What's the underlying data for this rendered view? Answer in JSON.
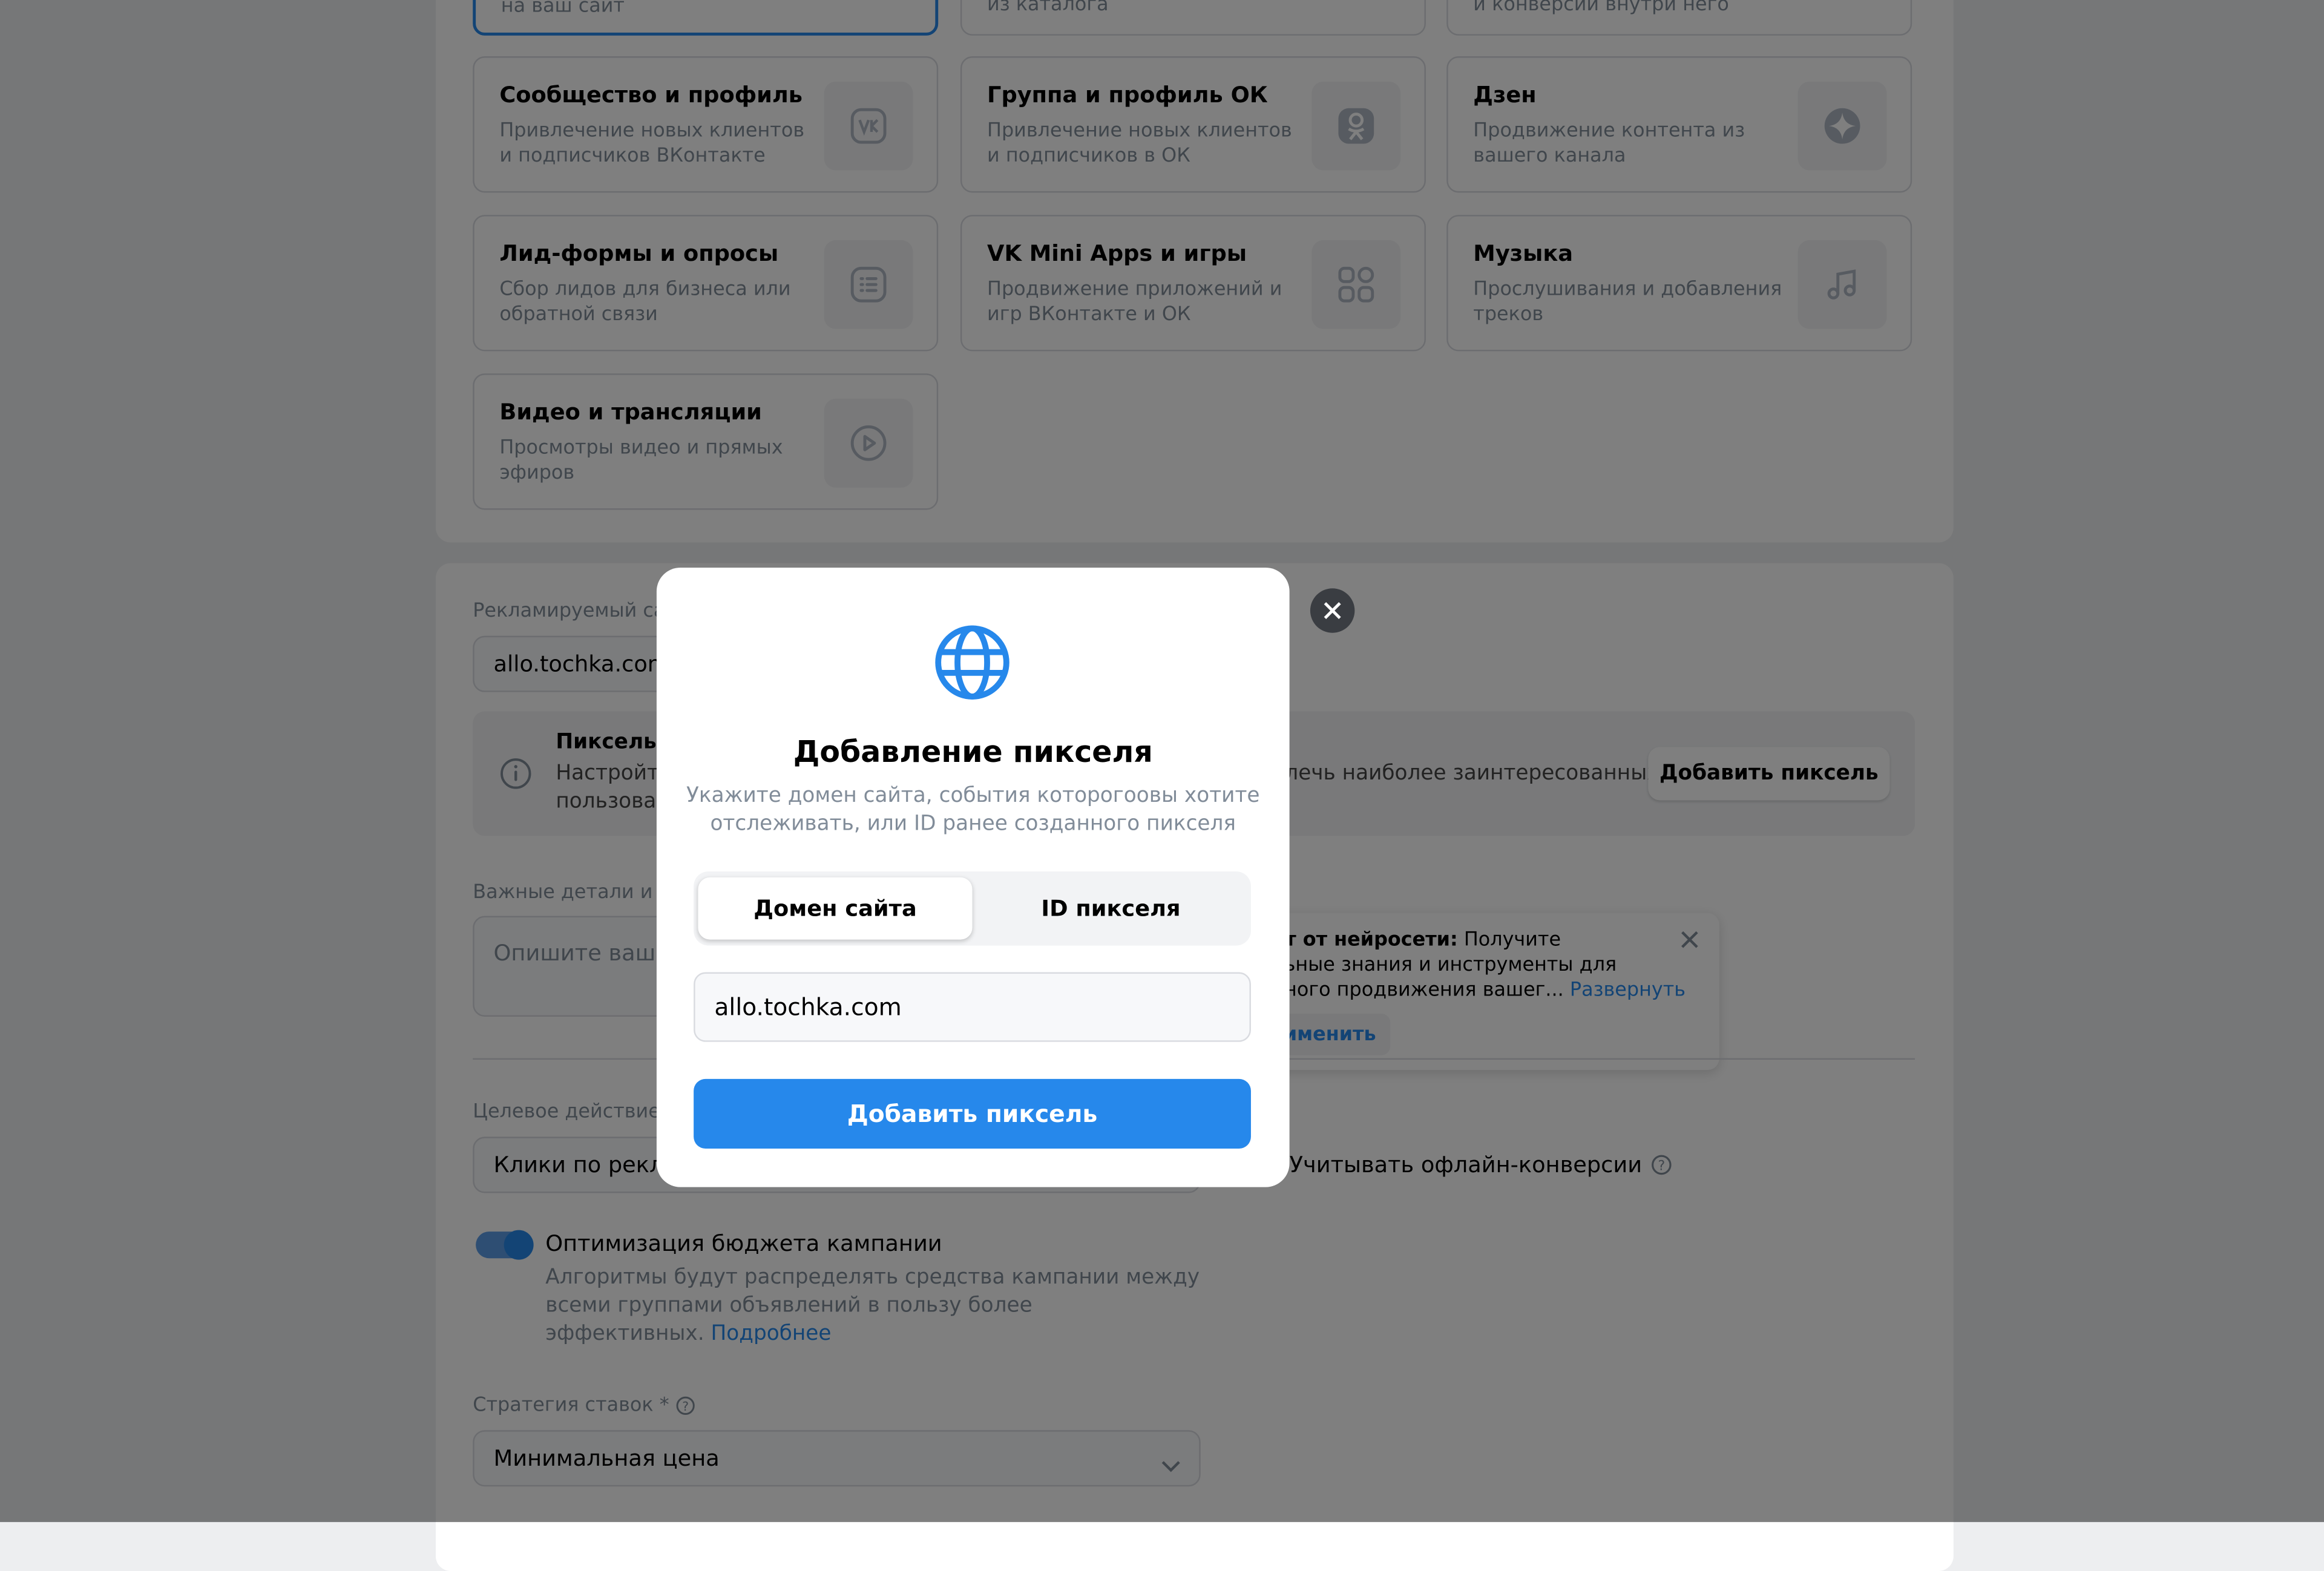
{
  "cards": [
    {
      "title": "Сообщество и профиль",
      "desc": "Привлечение новых клиентов и подписчиков ВКонтакте",
      "icon": "vk-icon"
    },
    {
      "title": "Группа и профиль ОК",
      "desc": "Привлечение новых клиентов и подписчиков в ОК",
      "icon": "ok-icon"
    },
    {
      "title": "Дзен",
      "desc": "Продвижение контента из вашего канала",
      "icon": "dzen-icon"
    },
    {
      "title": "Лид-формы и опросы",
      "desc": "Сбор лидов для бизнеса или обратной связи",
      "icon": "list-icon"
    },
    {
      "title": "VK Mini Apps и игры",
      "desc": "Продвижение приложений и игр ВКонтакте и ОК",
      "icon": "apps-icon"
    },
    {
      "title": "Музыка",
      "desc": "Прослушивания и добавления треков",
      "icon": "music-note-icon"
    },
    {
      "title": "Видео и трансляции",
      "desc": "Просмотры видео и прямых эфиров",
      "icon": "play-icon"
    }
  ],
  "top_cards": {
    "left": "на ваш сайт",
    "middle": "из каталога",
    "right": "и конверсии внутри него"
  },
  "site": {
    "label": "Рекламируемый сай",
    "value": "allo.tochka.com"
  },
  "pixel_notice": {
    "title": "Пиксель н",
    "line1": "Настройте",
    "line1_right": "лечь наиболее заинтересованных",
    "line2": "пользоват",
    "button": "Добавить пиксель"
  },
  "details": {
    "label": "Важные детали и от",
    "placeholder": "Опишите ваше"
  },
  "ai_tip": {
    "bold": "нт от нейросети:",
    "text1": " Получите",
    "text2": "льные знания и инструменты для",
    "text3": "нного продвижения вашег...",
    "expand": "Развернуть",
    "apply": "именить"
  },
  "target": {
    "label": "Целевое действие *",
    "value": "Клики по рекла",
    "offline": "Учитывать офлайн-конверсии"
  },
  "budget": {
    "title": "Оптимизация бюджета кампании",
    "desc1": "Алгоритмы будут распределять средства кампании между",
    "desc2": "всеми группами объявлений в пользу более",
    "desc3": "эффективных.",
    "more": "Подробнее",
    "enabled": true
  },
  "strategy": {
    "label": "Стратегия ставок *",
    "value": "Минимальная цена"
  },
  "modal": {
    "title": "Добавление пикселя",
    "subtitle1": "Укажите домен сайта, события которогоовы хотите",
    "subtitle2": "отслеживать, или ID ранее созданного пикселя",
    "tab_domain": "Домен сайта",
    "tab_id": "ID пикселя",
    "input_value": "allo.tochka.com",
    "submit": "Добавить пиксель"
  },
  "colors": {
    "accent": "#2688eb",
    "link": "#2688eb",
    "overlay": "rgba(0,0,0,0.5)"
  }
}
